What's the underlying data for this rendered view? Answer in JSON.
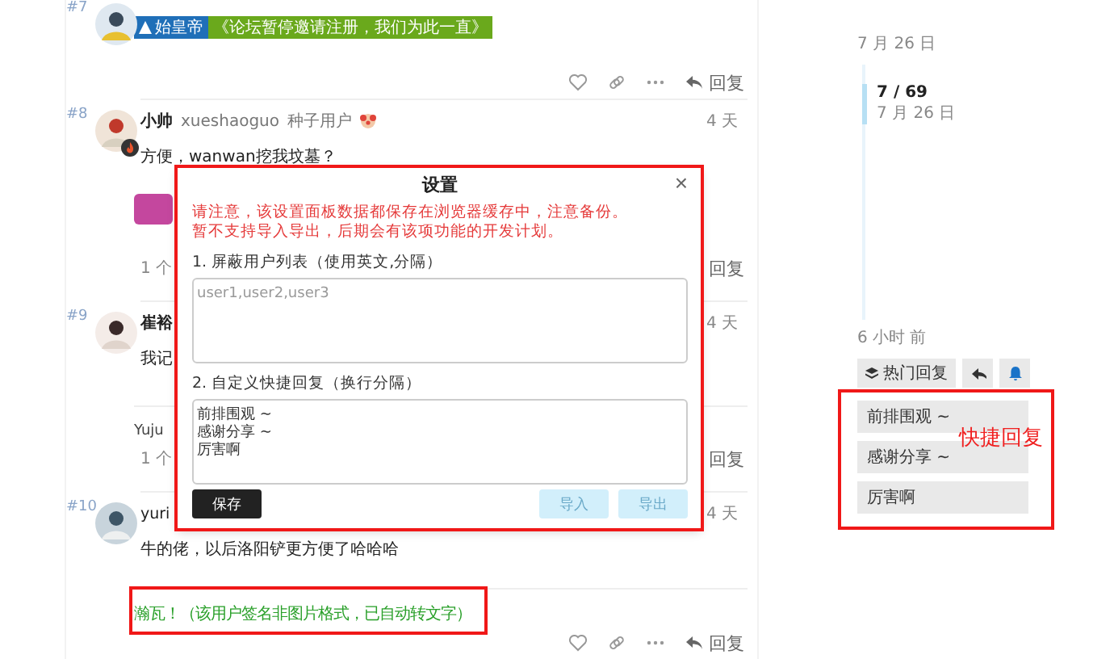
{
  "posts": [
    {
      "number": "#7",
      "flair": [
        {
          "kind": "rank",
          "text": "始皇帝"
        },
        {
          "kind": "motto",
          "text": "《论坛暂停邀请注册，我们为此一直》"
        }
      ],
      "reply": "回复"
    },
    {
      "number": "#8",
      "author": "小帅",
      "username": "xueshaoguo",
      "title": "种子用户",
      "time": "4 天",
      "body": "方便，wanwan挖我坟墓？",
      "replies": "1 个",
      "reply": "回复"
    },
    {
      "number": "#9",
      "author": "崔裕",
      "time": "4 天",
      "body": "我记",
      "signature": {
        "kind": "plain",
        "text": "Yuju"
      },
      "replies": "1 个",
      "reply": "回复"
    },
    {
      "number": "#10",
      "author": "yuri",
      "time": "4 天",
      "body": "牛的佬，以后洛阳铲更方便了哈哈哈",
      "signature": {
        "kind": "converted",
        "text": "瀚瓦！（该用户签名非图片格式，已自动转文字）"
      },
      "reply": "回复"
    }
  ],
  "dialog": {
    "title": "设置",
    "close": "×",
    "warnings": [
      "请注意，该设置面板数据都保存在浏览器缓存中，注意备份。",
      "暂不支持导入导出，后期会有该项功能的开发计划。"
    ],
    "fields": [
      {
        "label": "1. 屏蔽用户列表（使用英文,分隔）",
        "placeholder": "user1,user2,user3"
      },
      {
        "label": "2. 自定义快捷回复（换行分隔）",
        "value": "前排围观 ~\n感谢分享 ~\n厉害啊"
      }
    ],
    "buttons": [
      {
        "kind": "primary",
        "label": "保存"
      },
      {
        "kind": "secondary",
        "label": "导入"
      },
      {
        "kind": "secondary",
        "label": "导出"
      }
    ]
  },
  "sidebar": {
    "date_top": "7 月 26 日",
    "position": "7 / 69",
    "position_date": "7 月 26 日",
    "date_bottom": "6 小时 前",
    "buttons": [
      {
        "kind": "hot",
        "label": "热门回复"
      },
      {
        "kind": "reply"
      },
      {
        "kind": "notify"
      }
    ],
    "quick_replies": [
      "前排围观 ~",
      "感谢分享 ~",
      "厉害啊"
    ],
    "callout": "快捷回复"
  }
}
